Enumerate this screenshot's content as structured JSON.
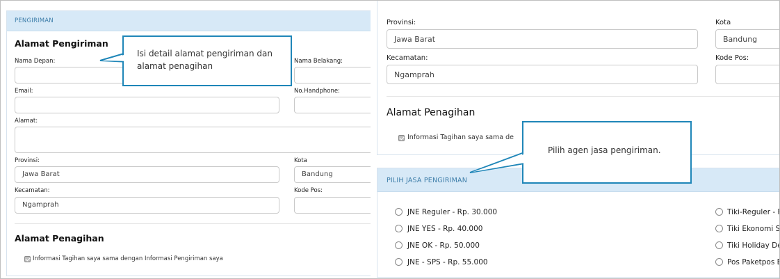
{
  "left": {
    "header": "PENGIRIMAN",
    "section_title": "Alamat Pengiriman",
    "fields": {
      "nama_depan_label": "Nama Depan:",
      "nama_belakang_label": "Nama Belakang:",
      "email_label": "Email:",
      "handphone_label": "No.Handphone:",
      "alamat_label": "Alamat:",
      "provinsi_label": "Provinsi:",
      "provinsi_value": "Jawa Barat",
      "kota_label": "Kota",
      "kota_value": "Bandung",
      "kecamatan_label": "Kecamatan:",
      "kecamatan_value": "Ngamprah",
      "kode_pos_label": "Kode Pos:"
    },
    "billing_title": "Alamat Penagihan",
    "billing_checkbox_label": "Informasi Tagihan saya sama dengan Informasi Pengiriman saya",
    "billing_checked": true,
    "callout_text": "Isi detail alamat pengiriman dan alamat penagihan"
  },
  "right": {
    "provinsi_label": "Provinsi:",
    "provinsi_value": "Jawa Barat",
    "kota_label": "Kota",
    "kota_value": "Bandung",
    "kecamatan_label": "Kecamatan:",
    "kecamatan_value": "Ngamprah",
    "kode_pos_label": "Kode Pos:",
    "billing_title": "Alamat Penagihan",
    "billing_checkbox_label": "Informasi Tagihan saya sama de",
    "billing_checked": true,
    "shipping_header": "PILIH JASA PENGIRIMAN",
    "shipping_options_left": [
      "JNE Reguler - Rp. 30.000",
      "JNE YES - Rp. 40.000",
      "JNE OK - Rp. 50.000",
      "JNE - SPS - Rp. 55.000"
    ],
    "shipping_options_right": [
      "Tiki-Reguler - R",
      "Tiki Ekonomi Se",
      "Tiki Holiday Del",
      "Pos Paketpos B"
    ],
    "callout_text": "Pilih agen jasa pengiriman."
  },
  "colors": {
    "header_bg": "#d7e9f7",
    "header_text": "#3b7ca8",
    "callout_border": "#1f86b8"
  }
}
